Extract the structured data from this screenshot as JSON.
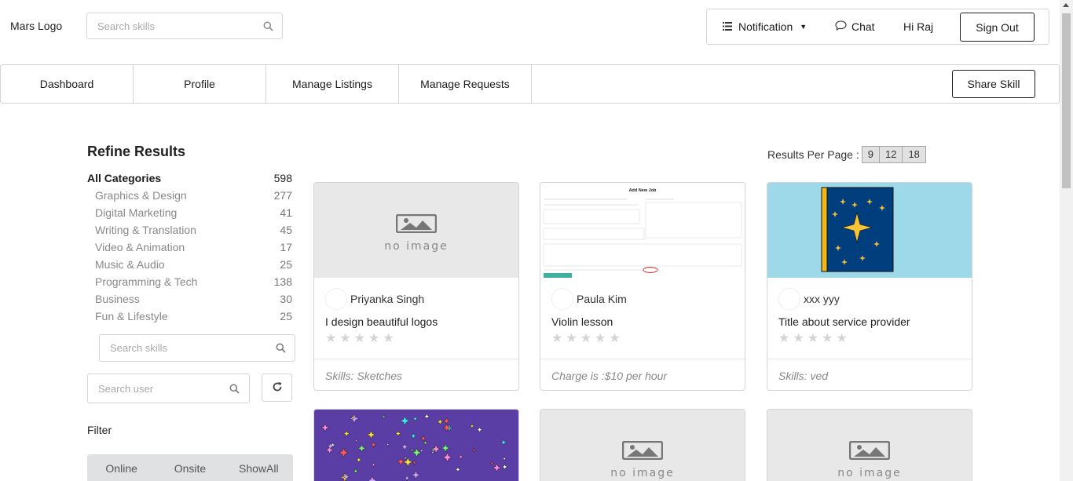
{
  "header": {
    "logo": "Mars Logo",
    "search_placeholder": "Search skills",
    "notification": "Notification",
    "chat": "Chat",
    "greeting": "Hi Raj",
    "sign_out": "Sign Out"
  },
  "nav": {
    "items": [
      "Dashboard",
      "Profile",
      "Manage Listings",
      "Manage Requests"
    ],
    "share_skill": "Share Skill"
  },
  "refine": {
    "title": "Refine Results",
    "all_label": "All Categories",
    "all_count": "598",
    "categories": [
      {
        "label": "Graphics & Design",
        "count": "277"
      },
      {
        "label": "Digital Marketing",
        "count": "41"
      },
      {
        "label": "Writing & Translation",
        "count": "45"
      },
      {
        "label": "Video & Animation",
        "count": "17"
      },
      {
        "label": "Music & Audio",
        "count": "25"
      },
      {
        "label": "Programming & Tech",
        "count": "138"
      },
      {
        "label": "Business",
        "count": "30"
      },
      {
        "label": "Fun & Lifestyle",
        "count": "25"
      }
    ],
    "skill_search_placeholder": "Search skills",
    "user_search_placeholder": "Search user",
    "filter_label": "Filter",
    "filters": [
      "Online",
      "Onsite",
      "ShowAll"
    ]
  },
  "results": {
    "per_page_label": "Results Per Page :",
    "per_page_options": [
      "9",
      "12",
      "18"
    ],
    "no_image_text": "no image",
    "screenshot_heading": "Add New Job",
    "cards": [
      {
        "owner": "Priyanka Singh",
        "title": "I design beautiful logos",
        "footer": "Skills: Sketches"
      },
      {
        "owner": "Paula Kim",
        "title": "Violin lesson",
        "footer": "Charge is :$10 per hour"
      },
      {
        "owner": "xxx yyy",
        "title": "Title about service provider",
        "footer": "Skills: ved"
      }
    ]
  },
  "colors": {
    "accent": "#1b1c1d",
    "border": "#d4d4d5",
    "muted": "#888888",
    "star_empty": "#d4d4d4",
    "book_bg": "#9dd9e8",
    "book_cover": "#003e7e",
    "stars_bg": "#5b3ea5"
  }
}
